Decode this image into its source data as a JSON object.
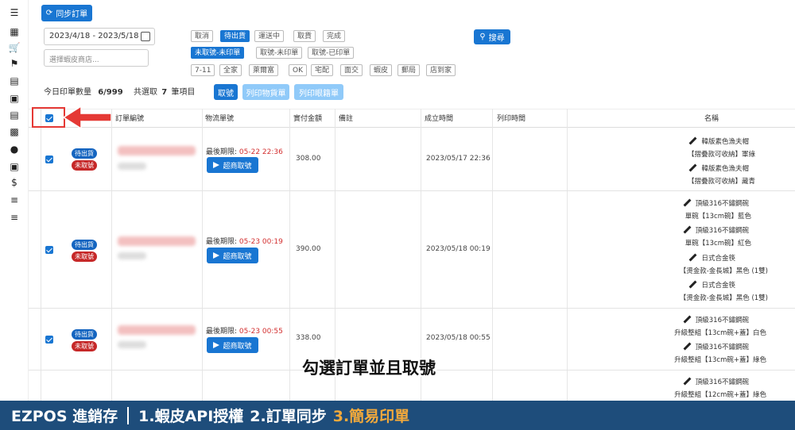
{
  "toolbar": {
    "sync_button": "同步訂單",
    "date_range": "2023/4/18 - 2023/5/18",
    "shop_placeholder": "選擇蝦皮商店...",
    "search_button": "搜尋",
    "status_chips": [
      "取消",
      "待出貨",
      "運送中",
      "取貨",
      "完成"
    ],
    "label_chips": [
      "未取號-未印單",
      "取號-未印單",
      "取號-已印單"
    ],
    "logistics_chips": [
      "7-11",
      "全家",
      "萊爾富",
      "OK",
      "宅配",
      "面交",
      "蝦皮",
      "郵局",
      "店到家"
    ],
    "today_print_label": "今日印單數量",
    "today_print_count": "6/999",
    "selected_prefix": "共選取",
    "selected_count": "7",
    "selected_suffix": "筆項目",
    "pick_button": "取號",
    "print_label_button": "列印物貨單",
    "print_shipping_button": "列印眼籍單"
  },
  "table": {
    "headers": [
      "訂單編號",
      "物流單號",
      "實付金額",
      "備註",
      "成立時間",
      "列印時間",
      "名稱"
    ],
    "deadline_label": "最後期限:",
    "pick_label": "超商取號",
    "rows": [
      {
        "status": "待出貨",
        "label_status": "未取號",
        "deadline": "05-22 22:36",
        "amount": "308.00",
        "created": "2023/05/17 22:36",
        "items": [
          {
            "name": "韓版素色漁夫帽",
            "variant": "【摺疊款可收納】軍綠"
          },
          {
            "name": "韓版素色漁夫帽",
            "variant": "【摺疊款可收納】藏青"
          }
        ]
      },
      {
        "status": "待出貨",
        "label_status": "未取號",
        "deadline": "05-23 00:19",
        "amount": "390.00",
        "created": "2023/05/18 00:19",
        "items": [
          {
            "name": "頂級316不鏽鋼碗",
            "variant": "單碗【13cm碗】藍色"
          },
          {
            "name": "頂級316不鏽鋼碗",
            "variant": "單碗【13cm碗】紅色"
          },
          {
            "name": "日式合金筷",
            "variant": "【燙金款-金長城】黑色 (1雙)"
          },
          {
            "name": "日式合金筷",
            "variant": "【燙金款-金長城】黑色 (1雙)"
          }
        ]
      },
      {
        "status": "待出貨",
        "label_status": "未取號",
        "deadline": "05-23 00:55",
        "amount": "338.00",
        "created": "2023/05/18 00:55",
        "items": [
          {
            "name": "頂級316不鏽鋼碗",
            "variant": "升級整組【13cm碗+蓋】白色"
          },
          {
            "name": "頂級316不鏽鋼碗",
            "variant": "升級整組【13cm碗+蓋】綠色"
          },
          {
            "name": "頂級316不鏽鋼碗",
            "variant": "升級整組【12cm碗+蓋】綠色"
          }
        ]
      }
    ]
  },
  "overlay": {
    "subtitle": "勾選訂單並且取號",
    "banner_brand": "EZPOS 進銷存",
    "banner_step1": "1.蝦皮API授權",
    "banner_step2": "2.訂單同步",
    "banner_step3": "3.簡易印單"
  },
  "colors": {
    "primary": "#1976d2",
    "danger": "#c62828",
    "banner_bg": "#1e4d7b",
    "banner_highlight": "#f2a93b"
  },
  "icons": [
    "menu-icon",
    "grid-icon",
    "cart-icon",
    "tag-icon",
    "truck-icon",
    "briefcase-icon",
    "list-icon",
    "bar-chart-icon",
    "user-icon",
    "settings-box-icon",
    "dollar-icon",
    "lines-icon",
    "lines-icon"
  ]
}
